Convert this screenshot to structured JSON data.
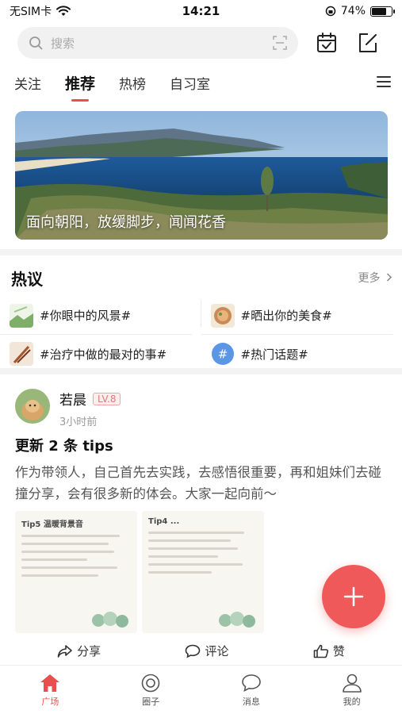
{
  "status_bar": {
    "carrier": "无SIM卡",
    "time": "14:21",
    "battery_text": "74%",
    "battery_level": 0.74
  },
  "search": {
    "placeholder": "搜索"
  },
  "tabs": [
    {
      "label": "关注",
      "active": false
    },
    {
      "label": "推荐",
      "active": true
    },
    {
      "label": "热榜",
      "active": false
    },
    {
      "label": "自习室",
      "active": false
    }
  ],
  "banner": {
    "caption": "面向朝阳，放缓脚步，闻闻花香"
  },
  "hot_topics": {
    "title": "热议",
    "more_label": "更多",
    "items": [
      {
        "label": "#你眼中的风景#",
        "thumb_icon": "landscape-thumb-icon"
      },
      {
        "label": "#晒出你的美食#",
        "thumb_icon": "food-thumb-icon"
      },
      {
        "label": "#治疗中做的最对的事#",
        "thumb_icon": "treatment-thumb-icon"
      },
      {
        "label": "#热门话题#",
        "thumb_icon": "hashtag-icon"
      }
    ]
  },
  "post": {
    "author": "若晨",
    "level": "LV.8",
    "time": "3小时前",
    "title": "更新 2 条 tips",
    "body": "作为带领人，自己首先去实践，去感悟很重要，再和姐妹们去碰撞分享，会有很多新的体会。大家一起向前～",
    "images": [
      {
        "title": "Tip5 温暖背景音"
      },
      {
        "title": "Tip4 ..."
      }
    ],
    "actions": {
      "share": "分享",
      "comment": "评论",
      "like": "赞"
    }
  },
  "tab_bar": [
    {
      "label": "广场",
      "icon": "home-icon",
      "active": true
    },
    {
      "label": "圈子",
      "icon": "circle-icon",
      "active": false
    },
    {
      "label": "消息",
      "icon": "message-icon",
      "active": false
    },
    {
      "label": "我的",
      "icon": "user-icon",
      "active": false
    }
  ],
  "colors": {
    "accent": "#e8504f",
    "fab": "#f0595a"
  }
}
